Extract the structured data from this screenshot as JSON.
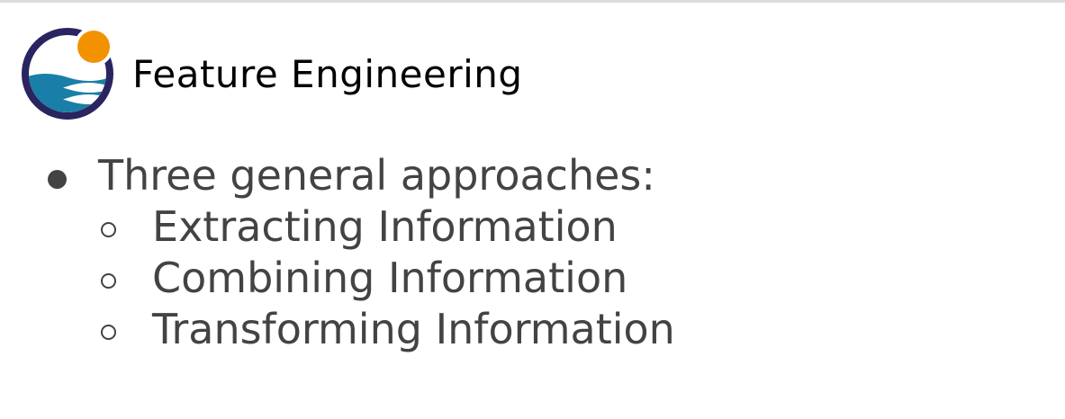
{
  "slide": {
    "title": "Feature Engineering",
    "logo_icon": "sun-over-waves-logo-icon",
    "bullets": {
      "main": "Three general approaches:",
      "sub": [
        "Extracting Information",
        "Combining Information",
        "Transforming Information"
      ]
    },
    "colors": {
      "logo_ring": "#2a2460",
      "logo_sun": "#f39200",
      "logo_waves": "#1a7fa8",
      "text": "#434343",
      "title": "#000000"
    }
  }
}
